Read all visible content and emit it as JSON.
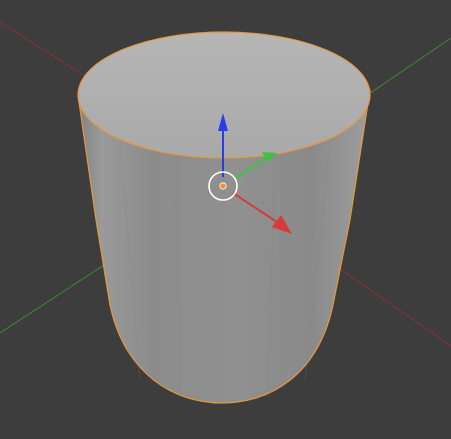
{
  "viewport": {
    "view": "3D Viewport",
    "object": {
      "type": "cylinder",
      "selected": true,
      "outline_color": "#e8973a"
    },
    "gizmo": {
      "type": "translate",
      "axes": [
        {
          "name": "x",
          "color": "#d83a3a"
        },
        {
          "name": "y",
          "color": "#3fc23f"
        },
        {
          "name": "z",
          "color": "#2a3ce6"
        }
      ]
    },
    "colors": {
      "background": "#3d3d3d",
      "grid_x_axis": "#8a2f35",
      "grid_y_axis": "#3e8a35",
      "origin_dot": "#f0902e"
    }
  }
}
